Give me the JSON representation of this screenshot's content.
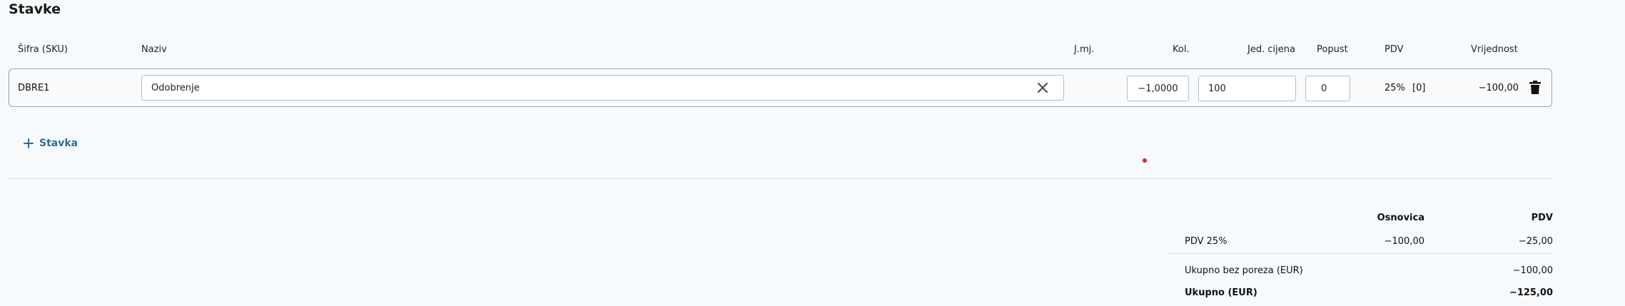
{
  "section_title": "Stavke",
  "columns": {
    "sku": "Šifra (SKU)",
    "name": "Naziv",
    "unit": "J.mj.",
    "qty": "Kol.",
    "unit_price": "Jed. cijena",
    "discount": "Popust",
    "vat": "PDV",
    "value": "Vrijednost"
  },
  "item": {
    "sku": "DBRE1",
    "name": "Odobrenje",
    "unit": "",
    "qty": "−1,0000",
    "unit_price": "100",
    "discount": "0",
    "vat_rate": "25%",
    "vat_code": "[0]",
    "value": "−100,00"
  },
  "add_item_label": "Stavka",
  "summary": {
    "col_base": "Osnovica",
    "col_vat": "PDV",
    "vat_row": {
      "label": "PDV 25%",
      "base": "−100,00",
      "vat": "−25,00"
    },
    "total_no_tax": {
      "label": "Ukupno bez poreza (EUR)",
      "value": "−100,00"
    },
    "total": {
      "label": "Ukupno (EUR)",
      "value": "−125,00"
    }
  },
  "icons": {
    "clear": "close-icon",
    "delete": "trash-icon",
    "add": "plus-icon"
  },
  "colors": {
    "accent": "#2b6d9a",
    "border": "#9aa3ad",
    "marker": "#e0202a"
  }
}
